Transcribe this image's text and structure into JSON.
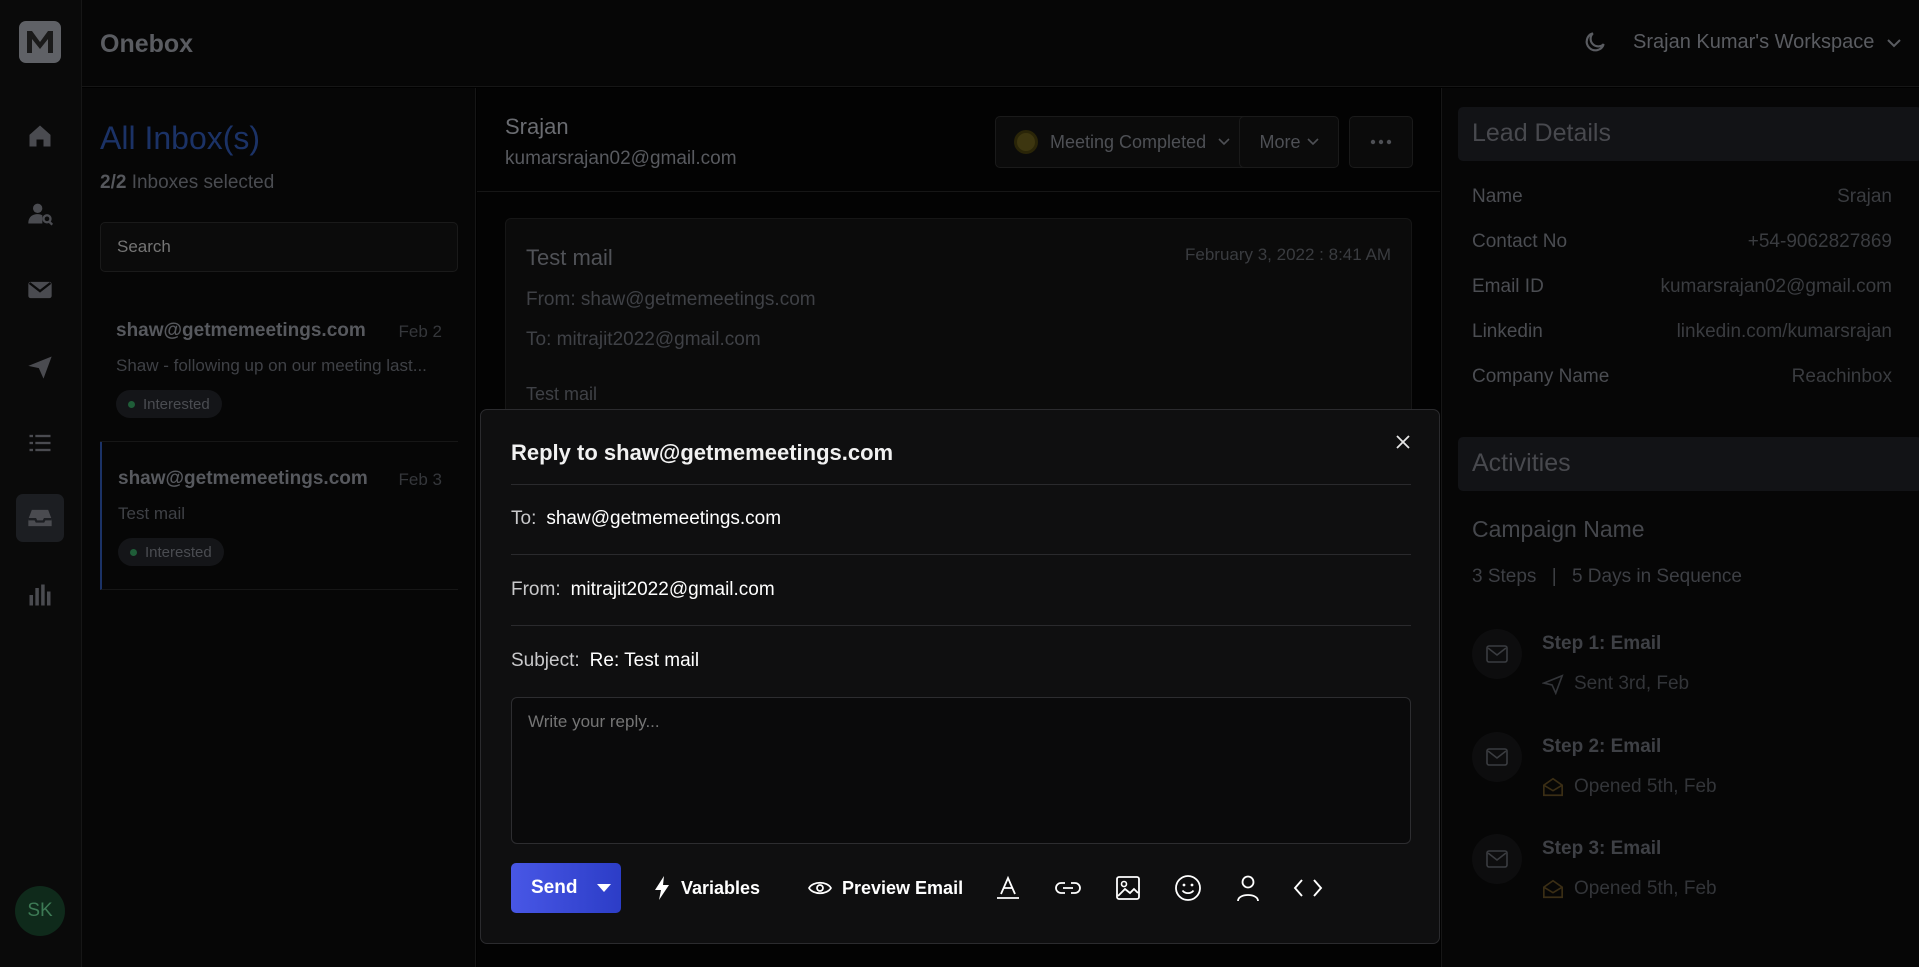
{
  "app": {
    "title": "Onebox",
    "logo_letter": "M"
  },
  "workspace": {
    "name": "Srajan Kumar's Workspace"
  },
  "rail": {
    "items": [
      {
        "icon": "home-icon"
      },
      {
        "icon": "user-search-icon"
      },
      {
        "icon": "mail-icon"
      },
      {
        "icon": "send-icon"
      },
      {
        "icon": "list-icon"
      },
      {
        "icon": "inbox-icon"
      },
      {
        "icon": "bar-chart-icon"
      }
    ],
    "avatar_initials": "SK"
  },
  "inbox": {
    "title": "All Inbox(s)",
    "count": "2/2",
    "count_label": "Inboxes selected",
    "search_placeholder": "Search",
    "threads": [
      {
        "from": "shaw@getmemeetings.com",
        "date": "Feb 2",
        "snippet": "Shaw - following up on our meeting last...",
        "badge": "Interested"
      },
      {
        "from": "shaw@getmemeetings.com",
        "date": "Feb 3",
        "snippet": "Test mail",
        "badge": "Interested"
      }
    ]
  },
  "thread_view": {
    "contact_name": "Srajan",
    "contact_email": "kumarsrajan02@gmail.com",
    "status_label": "Meeting Completed",
    "more_label": "More",
    "mail": {
      "subject": "Test mail",
      "date": "February 3, 2022 : 8:41 AM",
      "from": "From: shaw@getmemeetings.com",
      "to": "To: mitrajit2022@gmail.com",
      "body": "Test mail"
    }
  },
  "lead": {
    "title": "Lead Details",
    "rows": [
      {
        "key": "Name",
        "value": "Srajan"
      },
      {
        "key": "Contact No",
        "value": "+54-9062827869"
      },
      {
        "key": "Email ID",
        "value": "kumarsrajan02@gmail.com"
      },
      {
        "key": "Linkedin",
        "value": "linkedin.com/kumarsrajan"
      },
      {
        "key": "Company Name",
        "value": "Reachinbox"
      }
    ]
  },
  "activities": {
    "title": "Activities",
    "campaign_name": "Campaign Name",
    "steps_count": "3 Steps",
    "separator": "|",
    "days": "5 Days in Sequence",
    "steps": [
      {
        "title": "Step 1: Email",
        "status": "Sent 3rd, Feb",
        "icon": "send-icon"
      },
      {
        "title": "Step 2: Email",
        "status": "Opened 5th, Feb",
        "icon": "envelope-open-icon"
      },
      {
        "title": "Step 3: Email",
        "status": "Opened 5th, Feb",
        "icon": "envelope-open-icon"
      }
    ]
  },
  "reply": {
    "title": "Reply to shaw@getmemeetings.com",
    "to_label": "To:",
    "to_value": "shaw@getmemeetings.com",
    "from_label": "From:",
    "from_value": "mitrajit2022@gmail.com",
    "subject_label": "Subject:",
    "subject_value": "Re: Test mail",
    "placeholder": "Write your reply...",
    "send_label": "Send",
    "variables_label": "Variables",
    "preview_label": "Preview Email",
    "tools": [
      "text-format-icon",
      "link-icon",
      "image-icon",
      "emoji-icon",
      "user-icon",
      "code-icon"
    ]
  },
  "colors": {
    "accent": "#4857e6",
    "status_dot": "#3d3610",
    "badge_dot": "#1f5d38"
  }
}
